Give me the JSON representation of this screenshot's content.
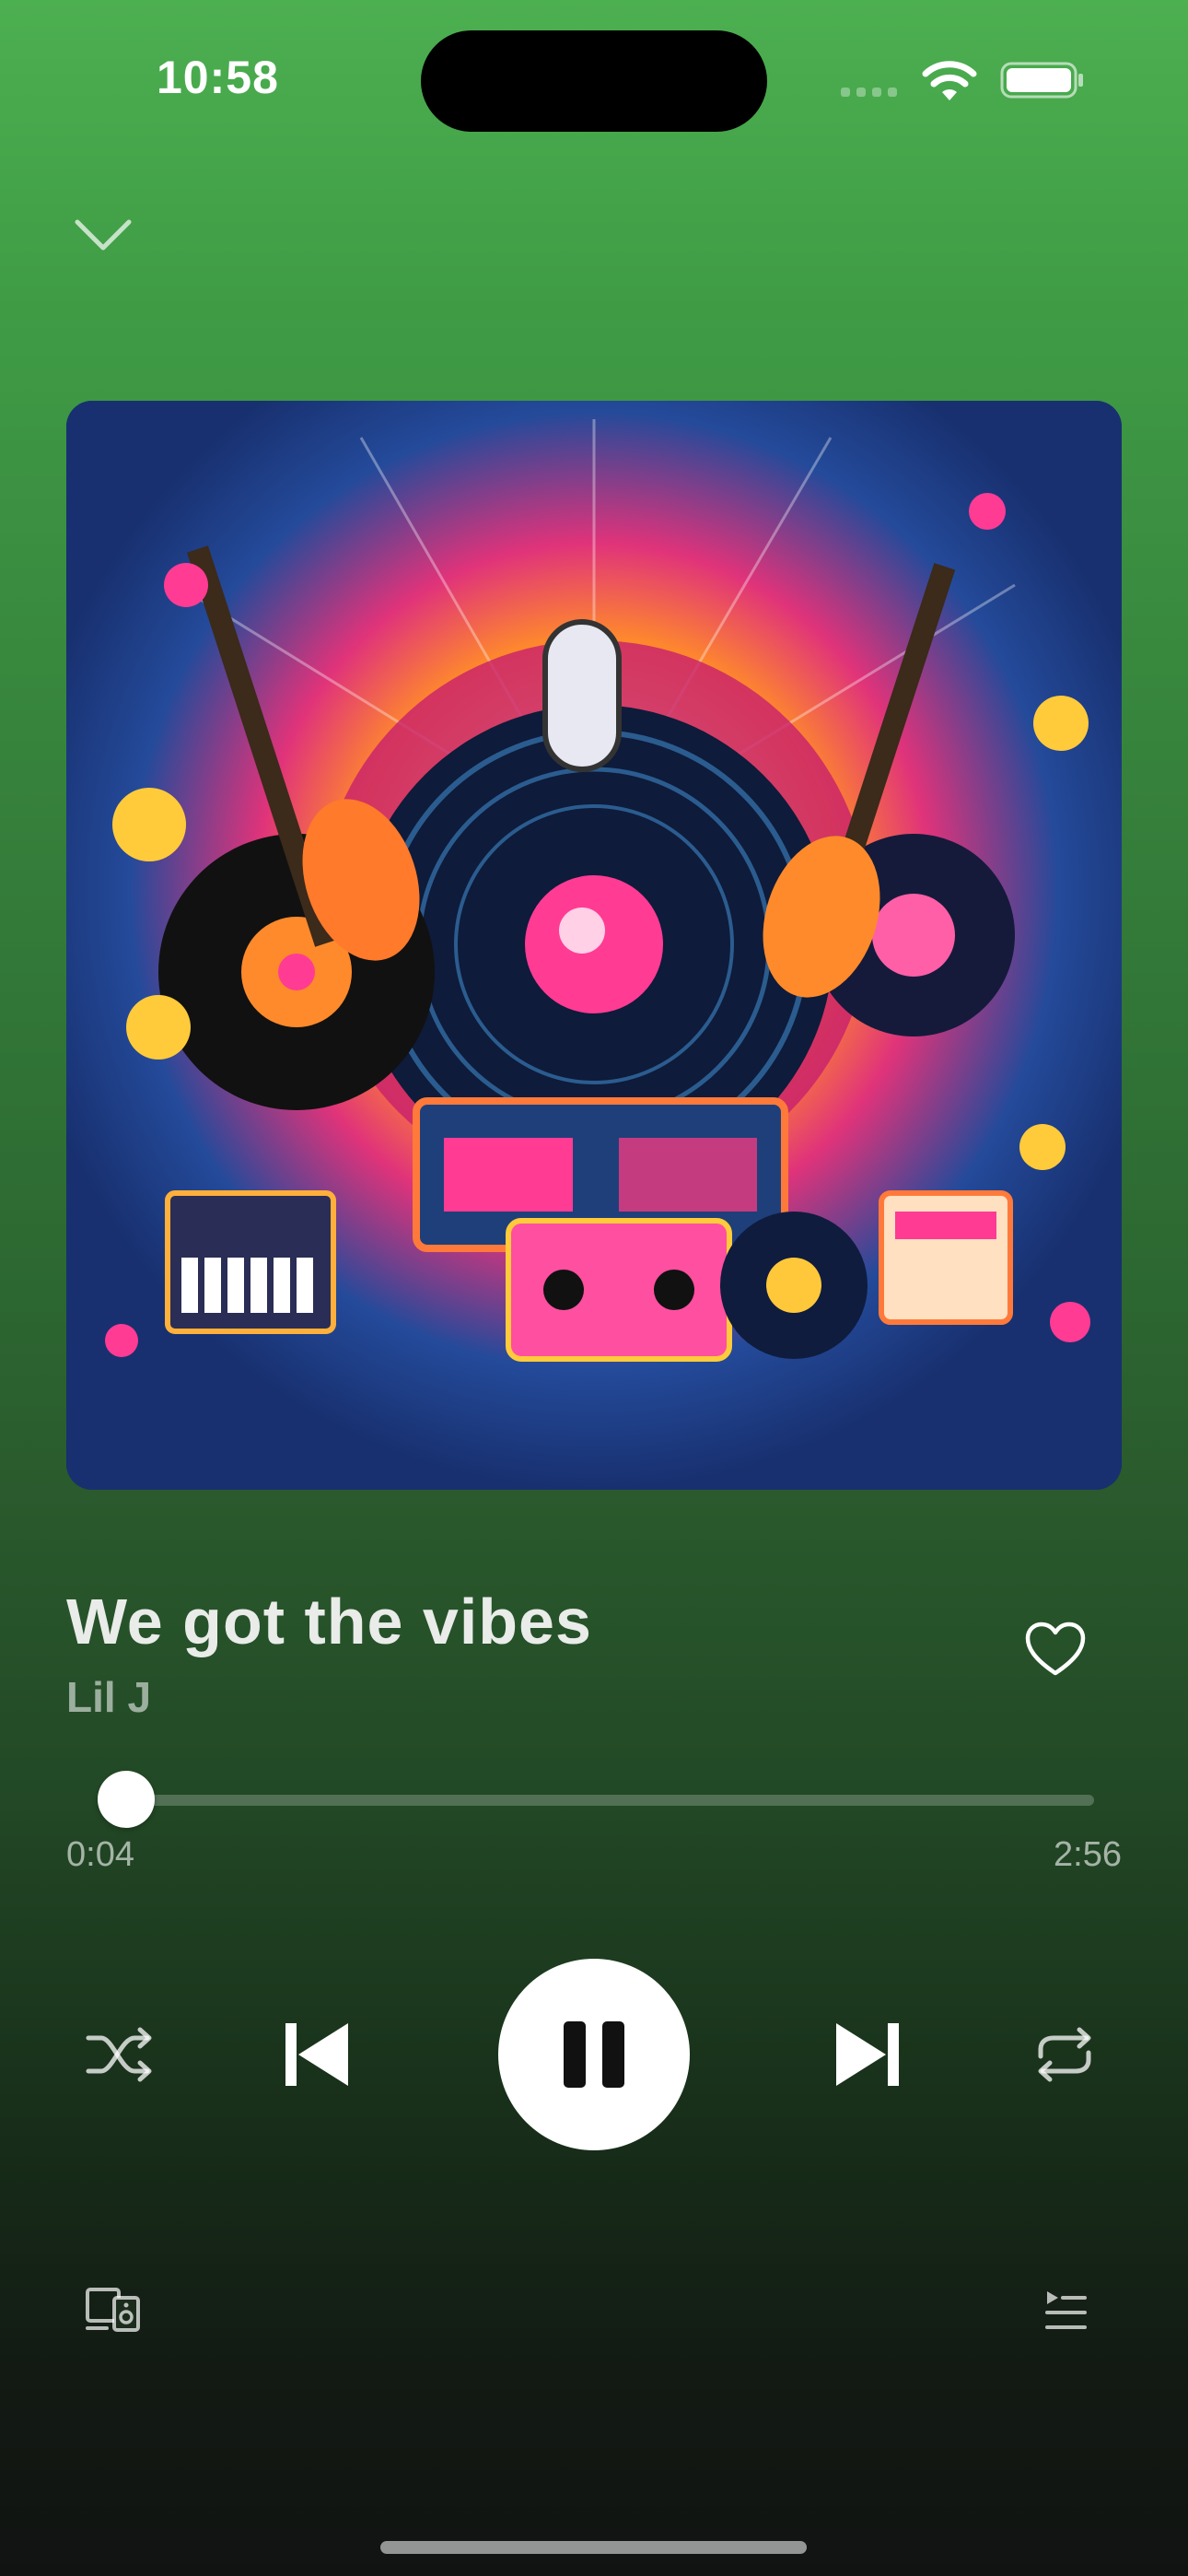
{
  "status_bar": {
    "time": "10:58",
    "icons": [
      "cellular-signal-icon",
      "wifi-icon",
      "battery-icon"
    ]
  },
  "header": {
    "collapse_icon": "chevron-down-icon"
  },
  "now_playing": {
    "title": "We got the vibes",
    "artist": "Lil J",
    "liked_icon": "heart-outline-icon"
  },
  "progress": {
    "elapsed": "0:04",
    "duration": "2:56",
    "fraction": 0.023
  },
  "controls": {
    "shuffle": "shuffle-icon",
    "previous": "skip-previous-icon",
    "play_pause": "pause-icon",
    "next": "skip-next-icon",
    "repeat": "repeat-icon"
  },
  "footer": {
    "devices": "connect-devices-icon",
    "queue": "queue-icon"
  },
  "colors": {
    "background_top": "#4caf50",
    "background_bottom": "#111312",
    "primary_text": "#e9ece9",
    "secondary_text": "#8ea18f"
  }
}
